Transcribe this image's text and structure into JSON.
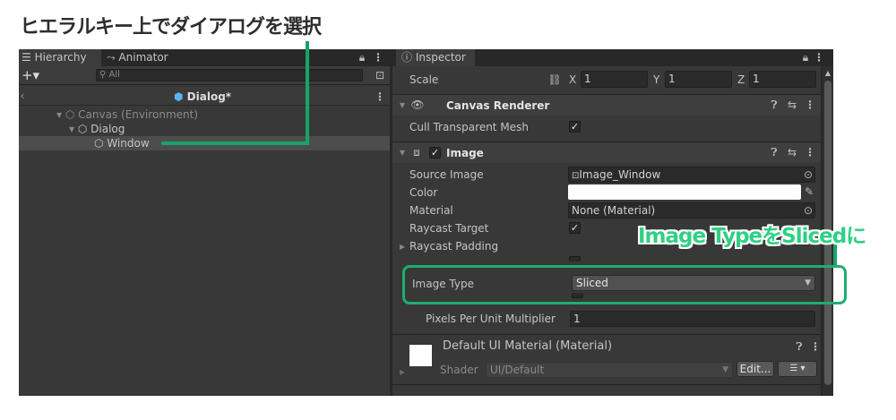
{
  "caption_top": "ヒエラルキー上でダイアログを選択",
  "caption_right": "Image TypeをSlicedに",
  "hierarchy": {
    "tabs": [
      {
        "label": "Hierarchy"
      },
      {
        "label": "Animator"
      }
    ],
    "search_placeholder": "All",
    "scene_title": "Dialog*",
    "items": [
      {
        "label": "Canvas (Environment)"
      },
      {
        "label": "Dialog"
      },
      {
        "label": "Window"
      }
    ]
  },
  "inspector": {
    "tab_label": "Inspector",
    "scale": {
      "label": "Scale",
      "x_label": "X",
      "x": "1",
      "y_label": "Y",
      "y": "1",
      "z_label": "Z",
      "z": "1"
    },
    "canvas_renderer": {
      "title": "Canvas Renderer",
      "cull_label": "Cull Transparent Mesh"
    },
    "image": {
      "title": "Image",
      "source_image_label": "Source Image",
      "source_image_value": "Image_Window",
      "color_label": "Color",
      "material_label": "Material",
      "material_value": "None (Material)",
      "raycast_target_label": "Raycast Target",
      "raycast_padding_label": "Raycast Padding",
      "image_type_label": "Image Type",
      "image_type_value": "Sliced",
      "ppu_label": "Pixels Per Unit Multiplier",
      "ppu_value": "1"
    },
    "material_section": {
      "title": "Default UI Material (Material)",
      "shader_label": "Shader",
      "shader_value": "UI/Default",
      "edit_label": "Edit..."
    }
  },
  "colors": {
    "accent_green": "#21ad72",
    "selected_row": "#4d4d4d"
  }
}
